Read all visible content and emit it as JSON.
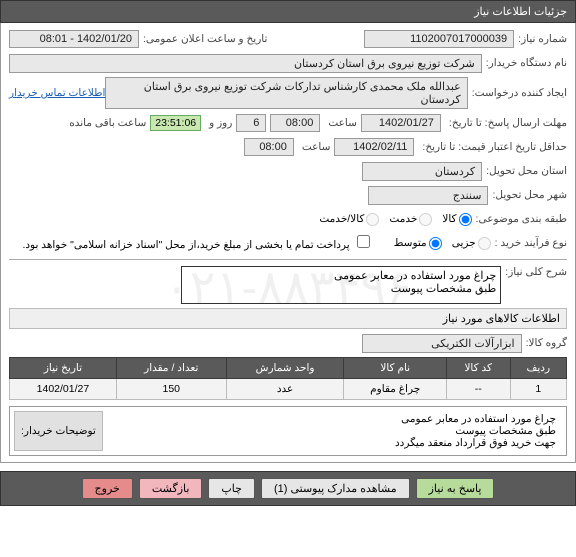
{
  "header": {
    "title": "جزئیات اطلاعات نیاز"
  },
  "fields": {
    "need_no_label": "شماره نیاز:",
    "need_no": "1102007017000039",
    "announce_label": "تاریخ و ساعت اعلان عمومی:",
    "announce_value": "1402/01/20 - 08:01",
    "buyer_label": "نام دستگاه خریدار:",
    "buyer": "شرکت توزیع نیروی برق استان کردستان",
    "requester_label": "ایجاد کننده درخواست:",
    "requester": "عبدالله ملک محمدی کارشناس تدارکات شرکت توزیع نیروی برق استان کردستان",
    "contact_link": "اطلاعات تماس خریدار",
    "deadline_label": "مهلت ارسال پاسخ: تا تاریخ:",
    "deadline_date": "1402/01/27",
    "time_label": "ساعت",
    "deadline_hour": "08:00",
    "day_label": "روز و",
    "days": "6",
    "hour_word": "ساعت",
    "countdown": "23:51:06",
    "remain": "ساعت باقی مانده",
    "quote_valid_label": "حداقل تاریخ اعتبار قیمت: تا تاریخ:",
    "quote_valid_date": "1402/02/11",
    "quote_valid_hour": "08:00",
    "province_label": "استان محل تحویل:",
    "province": "کردستان",
    "city_label": "شهر محل تحویل:",
    "city": "سنندج",
    "category_label": "طبقه بندی موضوعی:",
    "cat_goods": "کالا",
    "cat_service": "خدمت",
    "cat_goods_service": "کالا/خدمت",
    "proc_type_label": "نوع فرآیند خرید :",
    "proc_small": "جزیی",
    "proc_medium": "متوسط",
    "treasury_label": "پرداخت تمام یا بخشی از مبلغ خرید،از محل \"اسناد خزانه اسلامی\" خواهد بود.",
    "summary_label": "شرح کلی نیاز:",
    "summary_text": "چراغ مورد استفاده در معابر عمومی\nطبق مشخصات پیوست",
    "items_header": "اطلاعات کالاهای مورد نیاز",
    "group_label": "گروه کالا:",
    "group_value": "ابزارآلات الکتریکی",
    "columns": {
      "row": "ردیف",
      "code": "کد کالا",
      "name": "نام کالا",
      "unit": "واحد شمارش",
      "qty": "تعداد / مقدار",
      "date": "تاریخ نیاز"
    },
    "item": {
      "row": "1",
      "code": "--",
      "name": "چراغ مقاوم",
      "unit": "عدد",
      "qty": "150",
      "date": "1402/01/27"
    },
    "buyer_notes_label": "توضیحات خریدار:",
    "buyer_notes": "چراغ مورد استفاده در معابر عمومی\nطبق مشخصات پیوست\nجهت خرید فوق قرارداد منعقد میگردد"
  },
  "footer": {
    "reply": "پاسخ به نیاز",
    "attachments": "مشاهده مدارک پیوستی (1)",
    "print": "چاپ",
    "back": "بازگشت",
    "exit": "خروج"
  }
}
